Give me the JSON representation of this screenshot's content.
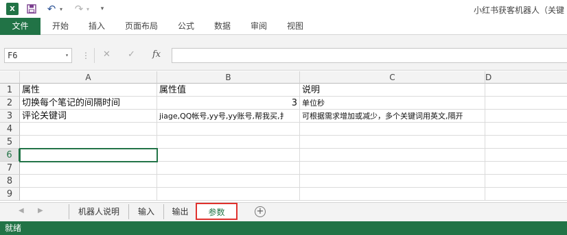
{
  "app": {
    "window_title": "小红书获客机器人（关键",
    "logo_letter": "X",
    "accent": "#217346"
  },
  "quick_access": {
    "undo_glyph": "↶",
    "redo_glyph": "↷",
    "more_glyph": "▾"
  },
  "ribbon_tabs": [
    "文件",
    "开始",
    "插入",
    "页面布局",
    "公式",
    "数据",
    "审阅",
    "视图"
  ],
  "formula_bar": {
    "name_box": "F6",
    "cancel_glyph": "✕",
    "enter_glyph": "✓",
    "fx_label": "fx",
    "formula": ""
  },
  "columns": [
    "A",
    "B",
    "C",
    "D"
  ],
  "rows": [
    "1",
    "2",
    "3",
    "4",
    "5",
    "6",
    "7",
    "8",
    "9"
  ],
  "cells": {
    "A1": "属性",
    "B1": "属性值",
    "C1": "说明",
    "A2": "切换每个笔记的间隔时间",
    "B2": "3",
    "C2": "单位秒",
    "A3": "评论关键词",
    "B3": "jiage,QQ帐号,yy号,yy账号,帮我买,扌",
    "C3": "可根据需求增加或减少，多个关键词用英文,隔开"
  },
  "sheets": [
    "机器人说明",
    "输入",
    "输出",
    "参数"
  ],
  "active_sheet": "参数",
  "add_sheet_glyph": "+",
  "status": "就绪"
}
